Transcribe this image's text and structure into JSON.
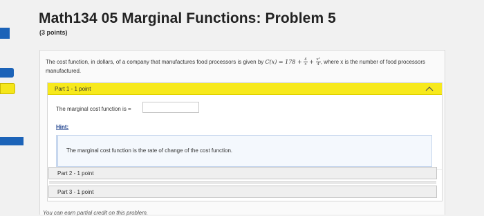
{
  "page": {
    "title": "Math134 05 Marginal Functions: Problem 5",
    "points": "(3 points)"
  },
  "question": {
    "text_before": "The cost function, in dollars, of a company that manufactures food processors is given by ",
    "formula_lhs": "C(x) = 178 + ",
    "frac1_num": "4",
    "frac1_den": "x",
    "plus": " + ",
    "frac2_num": "x²",
    "frac2_den": "4",
    "text_after": ", where x is the number of food processors manufactured."
  },
  "part1": {
    "label": "Part 1 - 1 point",
    "prompt": "The marginal cost function is =",
    "input_value": "",
    "hint_label": "Hint:",
    "hint_text": "The marginal cost function is the rate of change of the cost function."
  },
  "part2": {
    "label": "Part 2 - 1 point"
  },
  "part3": {
    "label": "Part 3 - 1 point"
  },
  "footer": {
    "partial_credit": "You can earn partial credit on this problem."
  },
  "colors": {
    "accent_yellow": "#f7e91c",
    "link_blue": "#1b3f8c",
    "tab_blue": "#1c63b8"
  },
  "icons": {
    "collapse": "chevron-up-icon"
  }
}
